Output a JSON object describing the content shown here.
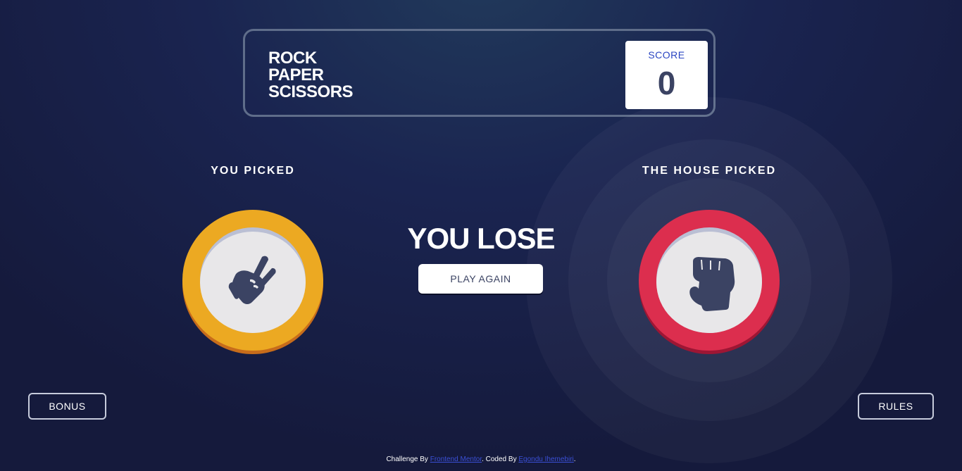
{
  "header": {
    "title_lines": [
      "ROCK",
      "PAPER",
      "SCISSORS"
    ],
    "score_label": "SCORE",
    "score_value": "0"
  },
  "player": {
    "label": "YOU PICKED",
    "choice": "scissors",
    "icon": "scissors-hand-icon",
    "rim_color": "#eca922",
    "rim_shadow_color": "#c76c1b"
  },
  "house": {
    "label": "THE HOUSE PICKED",
    "choice": "rock",
    "icon": "rock-fist-icon",
    "rim_color": "#dc2e4e",
    "rim_shadow_color": "#9d1634"
  },
  "result": {
    "text": "YOU LOSE",
    "play_again_label": "PLAY AGAIN"
  },
  "buttons": {
    "bonus_label": "BONUS",
    "rules_label": "RULES"
  },
  "footer": {
    "prefix": "Challenge By ",
    "link1": "Frontend Mentor",
    "middle": ". Coded By ",
    "link2": "Egondu Ihemebiri",
    "suffix": "."
  },
  "colors": {
    "icon_fill": "#3b4363",
    "score_label": "#2a45c2",
    "score_value": "#3b4363"
  }
}
